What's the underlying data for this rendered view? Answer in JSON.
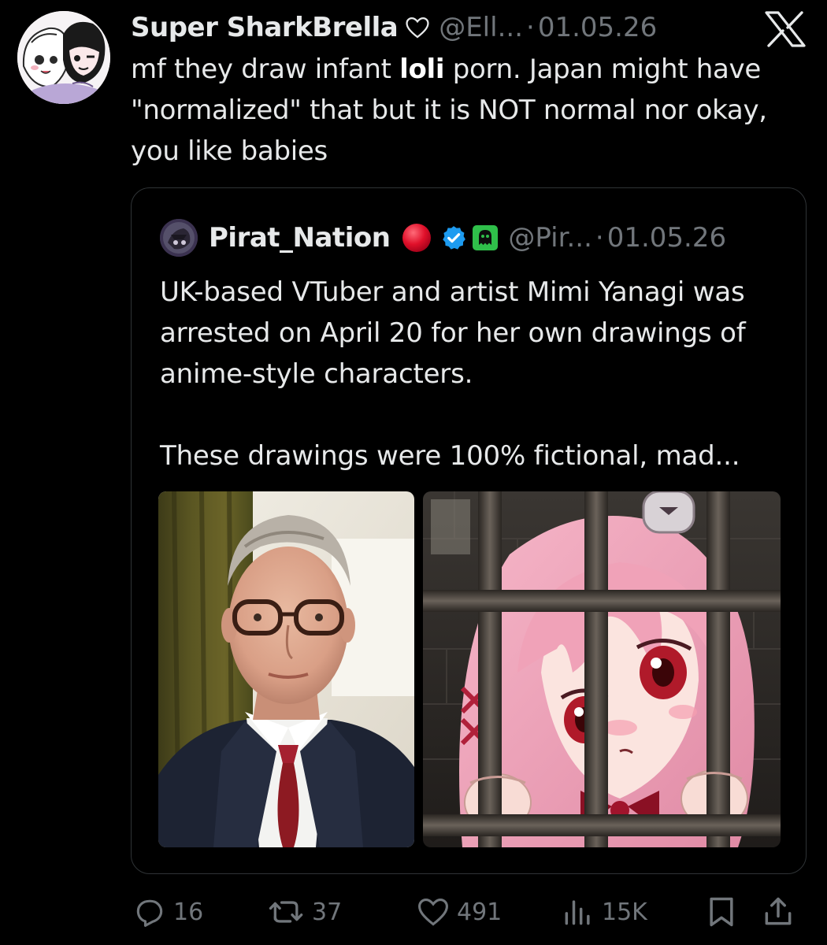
{
  "tweet": {
    "author": {
      "display_name": "Super SharkBrella",
      "badge_icon": "heart-outline-icon",
      "handle": "@Ell...",
      "separator": "·",
      "date": "01.05.26"
    },
    "platform_icon": "x-logo-icon",
    "text": {
      "segment_1": "mf they draw infant ",
      "bold": "loli",
      "segment_2": " porn. Japan might have \"normalized\" that but it is NOT normal nor okay, you like babies"
    }
  },
  "quote": {
    "author": {
      "display_name": "Pirat_Nation",
      "badges": [
        "red-circle-icon",
        "verified-badge-icon",
        "ghost-badge-icon"
      ],
      "handle": "@Pir...",
      "separator": "·",
      "date": "01.05.26"
    },
    "paragraph_1": "UK-based VTuber and artist Mimi Yanagi was arrested on April 20 for her own drawings of anime-style characters.",
    "paragraph_2": "These drawings were 100% fictional, mad...",
    "media": [
      {
        "kind": "photo",
        "subject": "man-in-suit-portrait"
      },
      {
        "kind": "illustration",
        "subject": "anime-girl-behind-bars"
      }
    ]
  },
  "actions": {
    "replies": "16",
    "reposts": "37",
    "likes": "491",
    "views": "15K"
  },
  "colors": {
    "background": "#000000",
    "text": "#e7e9ea",
    "muted": "#71767b",
    "border": "#2f3336",
    "verified": "#1d9bf0",
    "ghost_badge": "#2fbf4a",
    "red_badge": "#e0102a"
  }
}
